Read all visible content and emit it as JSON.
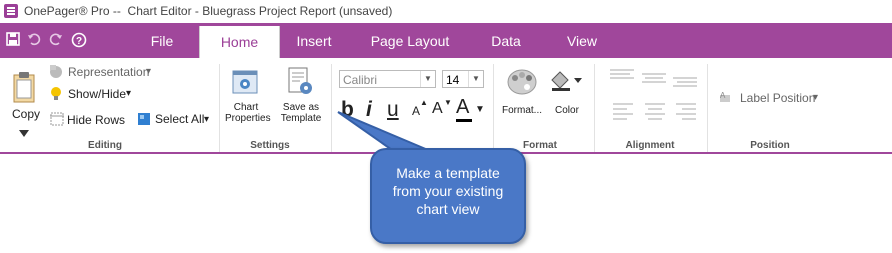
{
  "window": {
    "title": "OnePager® Pro --  Chart Editor - Bluegrass Project Report (unsaved)"
  },
  "tabs": [
    {
      "label": "File"
    },
    {
      "label": "Home"
    },
    {
      "label": "Insert"
    },
    {
      "label": "Page Layout"
    },
    {
      "label": "Data"
    },
    {
      "label": "View"
    }
  ],
  "ribbon": {
    "editing": {
      "label": "Editing",
      "copy": "Copy",
      "representation": "Representation",
      "show_hide": "Show/Hide",
      "hide_rows": "Hide Rows",
      "select_all": "Select All"
    },
    "settings": {
      "label": "Settings",
      "chart_properties_line1": "Chart",
      "chart_properties_line2": "Properties",
      "save_template_line1": "Save as",
      "save_template_line2": "Template"
    },
    "font": {
      "family": "Calibri",
      "size": "14",
      "bold": "b",
      "italic": "i",
      "underline": "u",
      "grow": "A",
      "shrink": "A",
      "color": "A"
    },
    "format": {
      "label": "Format",
      "format_painter": "Format...",
      "color": "Color"
    },
    "alignment": {
      "label": "Alignment"
    },
    "position": {
      "label": "Position",
      "label_position": "Label Position"
    }
  },
  "callout": {
    "line1": "Make a template",
    "line2": "from your existing",
    "line3": "chart view"
  },
  "colors": {
    "accent": "#a0479b",
    "callout": "#4a78c7"
  }
}
